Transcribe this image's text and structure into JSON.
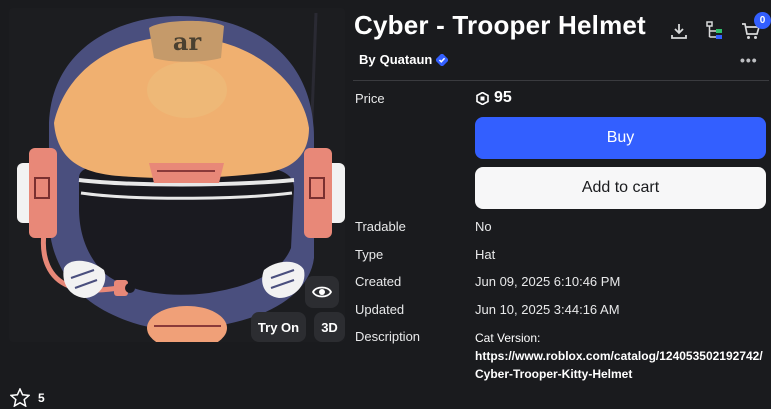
{
  "preview": {
    "helmet_logo_text": "ar",
    "try_on_label": "Try On",
    "view_3d_label": "3D"
  },
  "item": {
    "title": "Cyber - Trooper Helmet",
    "by_prefix": "By",
    "creator": "Quataun"
  },
  "header": {
    "cart_count": "0",
    "more_label": "•••"
  },
  "price": {
    "label": "Price",
    "value": "95"
  },
  "actions": {
    "buy_label": "Buy",
    "add_to_cart_label": "Add to cart"
  },
  "details": {
    "tradable_label": "Tradable",
    "tradable_value": "No",
    "type_label": "Type",
    "type_value": "Hat",
    "created_label": "Created",
    "created_value": "Jun 09, 2025 6:10:46 PM",
    "updated_label": "Updated",
    "updated_value": "Jun 10, 2025 3:44:16 AM",
    "description_label": "Description",
    "description_line1": "Cat Version:",
    "description_link": "https://www.roblox.com/catalog/124053502192742/Cyber-Trooper-Kitty-Helmet"
  },
  "favorites": {
    "count": "5"
  },
  "colors": {
    "background": "#1a1b1e",
    "buy_button": "#335fff",
    "cart_button": "#f7f7f8",
    "verified": "#335fff"
  }
}
